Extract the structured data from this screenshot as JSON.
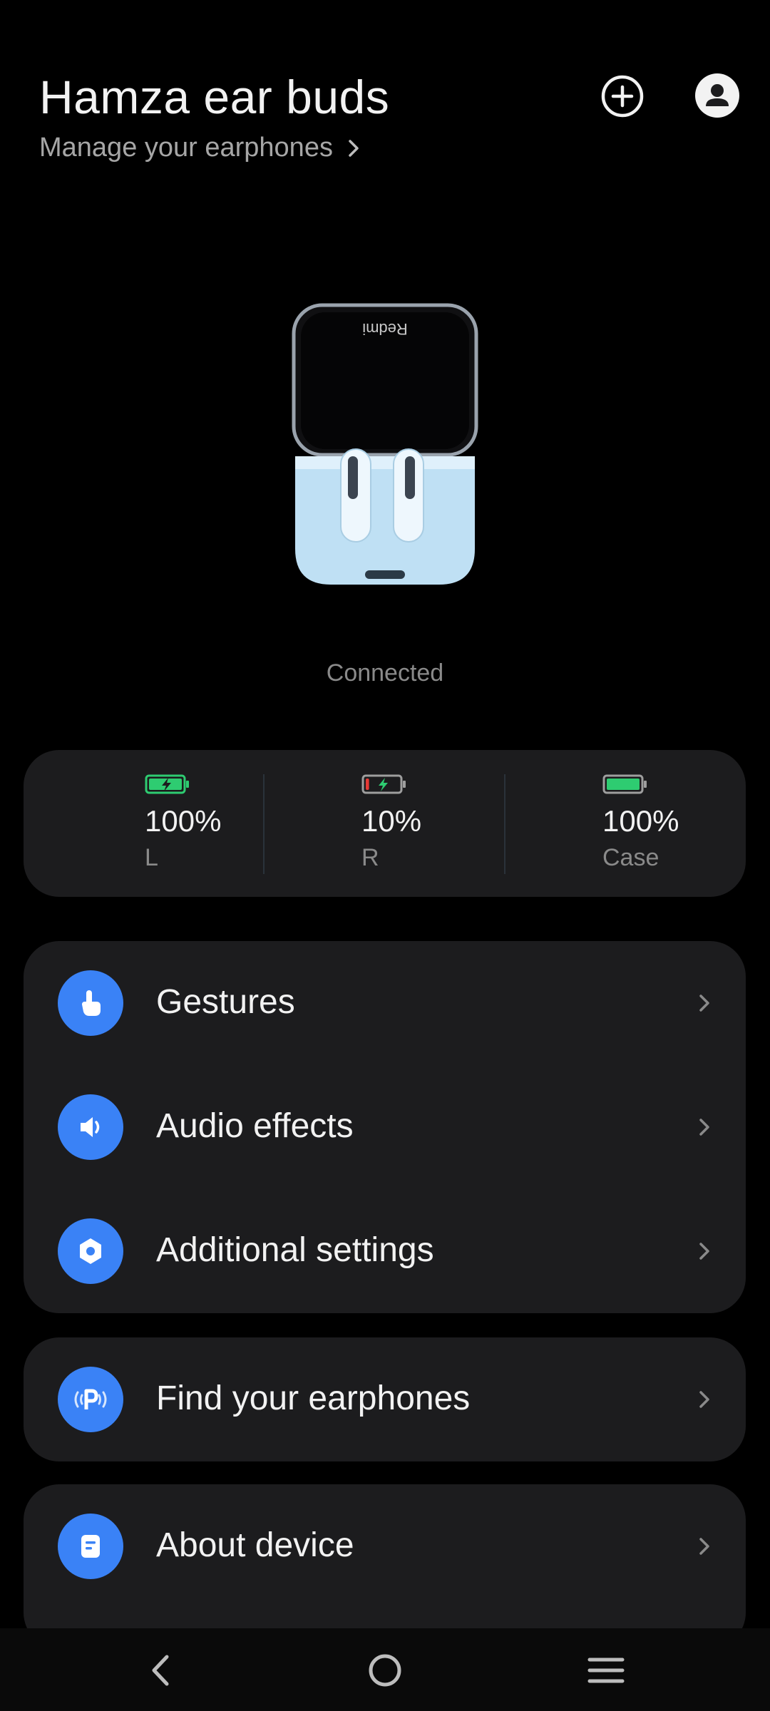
{
  "header": {
    "title": "Hamza ear buds",
    "subtitle": "Manage your earphones"
  },
  "icons": {
    "add": "plus-circle-icon",
    "profile": "user-avatar-icon",
    "subtitle_chevron": "chevron-right-icon"
  },
  "device": {
    "brand_on_lid": "Redmi",
    "status": "Connected"
  },
  "battery": [
    {
      "label": "L",
      "value": "100%",
      "level": 1.0,
      "charging": true,
      "color": "#2ecc71"
    },
    {
      "label": "R",
      "value": "10%",
      "level": 0.1,
      "charging": true,
      "color": "#e53935"
    },
    {
      "label": "Case",
      "value": "100%",
      "level": 1.0,
      "charging": false,
      "color": "#2ecc71"
    }
  ],
  "menu": {
    "gestures": "Gestures",
    "audio_effects": "Audio effects",
    "additional_settings": "Additional settings",
    "find_earphones": "Find your earphones",
    "about_device": "About device"
  },
  "colors": {
    "accent": "#3a82f6",
    "card_bg": "#1c1c1e",
    "background": "#000000"
  }
}
